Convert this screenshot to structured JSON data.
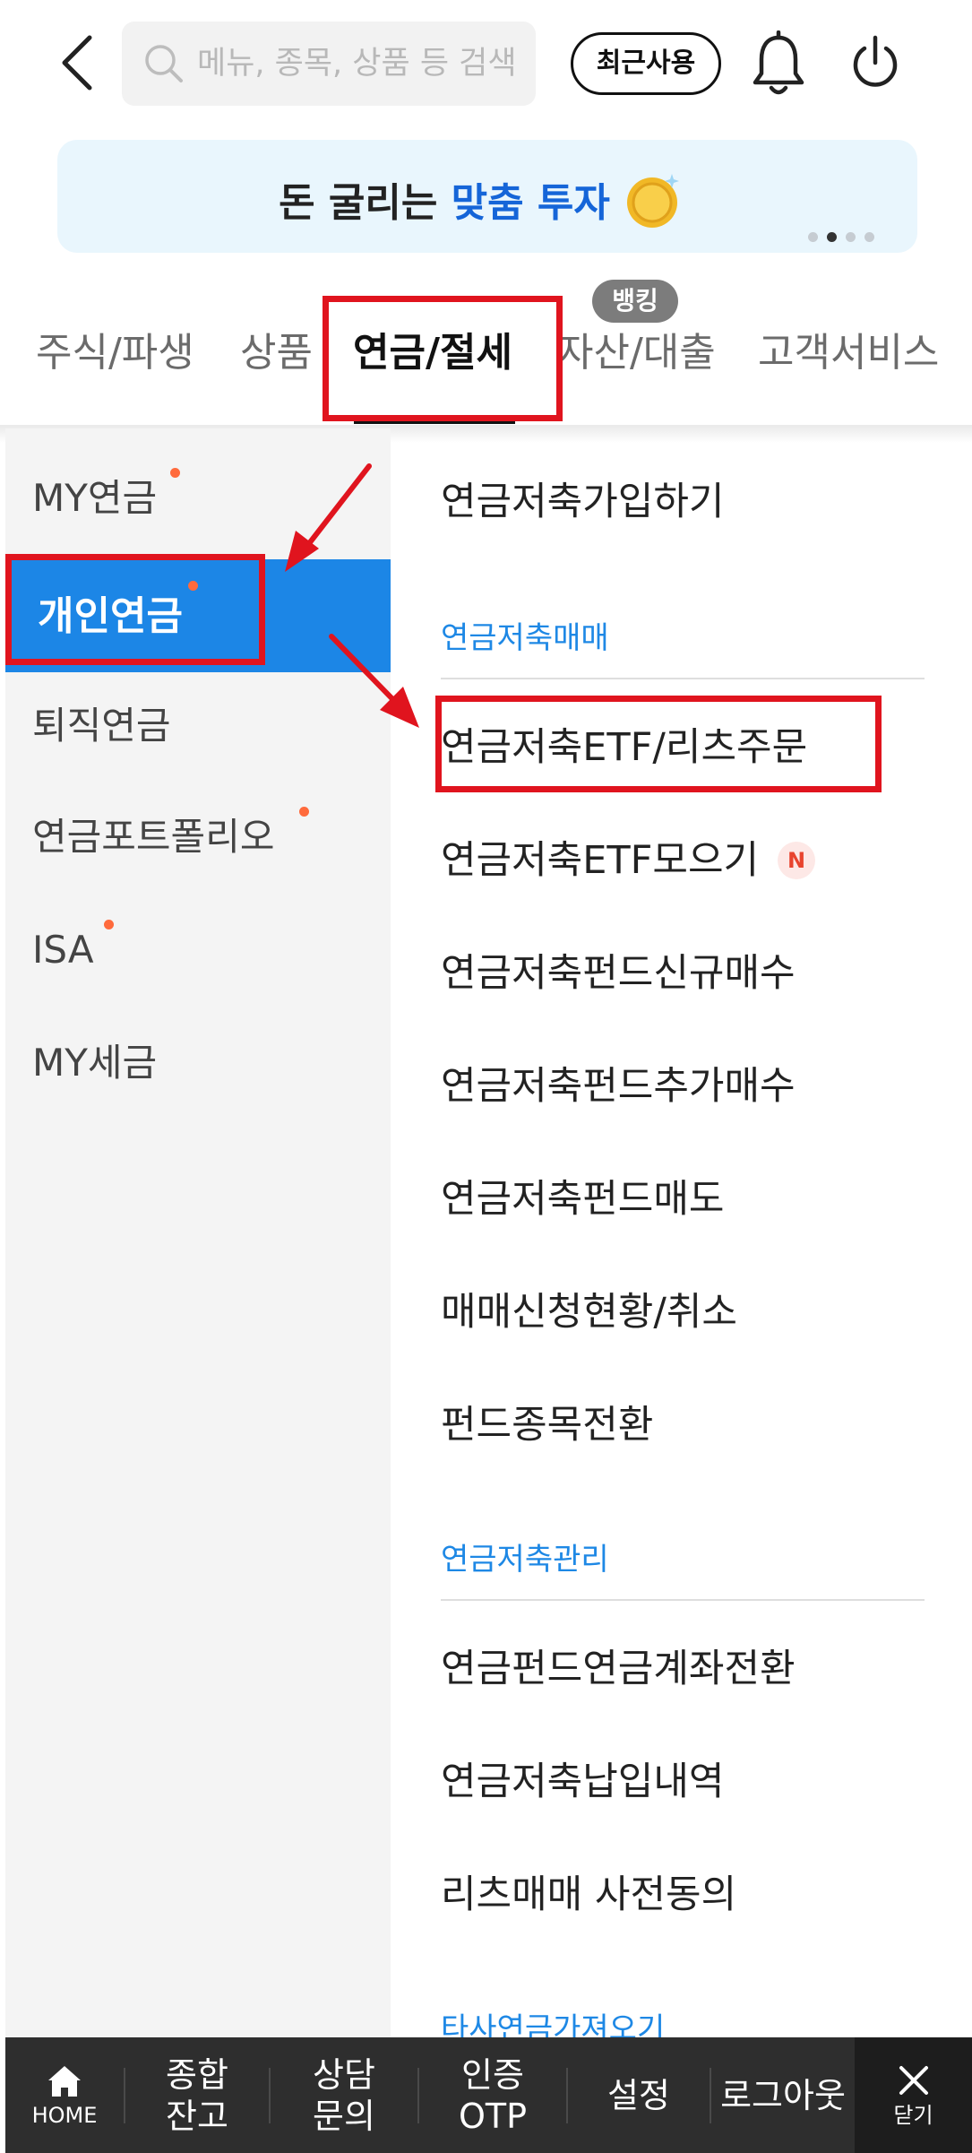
{
  "search": {
    "placeholder": "메뉴, 종목, 상품 등 검색"
  },
  "header": {
    "recent_label": "최근사용"
  },
  "banner": {
    "text_normal": "돈 굴리는 ",
    "text_highlight": "맞춤 투자",
    "page_count": 4,
    "active_page": 2
  },
  "tabs": [
    {
      "label": "주식/파생"
    },
    {
      "label": "상품"
    },
    {
      "label": "연금/절세",
      "active": true
    },
    {
      "label": "자산/대출",
      "badge": "뱅킹"
    },
    {
      "label": "고객서비스"
    }
  ],
  "left_menu": [
    {
      "label": "MY연금",
      "dot": true
    },
    {
      "label": "개인연금",
      "dot": true,
      "active": true
    },
    {
      "label": "퇴직연금",
      "dot": false
    },
    {
      "label": "연금포트폴리오",
      "dot": true
    },
    {
      "label": "ISA",
      "dot": true
    },
    {
      "label": "MY세금",
      "dot": false
    }
  ],
  "right_menu": {
    "top_item": "연금저축가입하기",
    "sections": [
      {
        "title": "연금저축매매",
        "items": [
          {
            "label": "연금저축ETF/리츠주문"
          },
          {
            "label": "연금저축ETF모으기",
            "badge": "N"
          },
          {
            "label": "연금저축펀드신규매수"
          },
          {
            "label": "연금저축펀드추가매수"
          },
          {
            "label": "연금저축펀드매도"
          },
          {
            "label": "매매신청현황/취소"
          },
          {
            "label": "펀드종목전환"
          }
        ]
      },
      {
        "title": "연금저축관리",
        "items": [
          {
            "label": "연금펀드연금계좌전환"
          },
          {
            "label": "연금저축납입내역"
          },
          {
            "label": "리츠매매 사전동의"
          }
        ]
      },
      {
        "title": "타사연금가져오기"
      }
    ]
  },
  "bottom_bar": {
    "home": "HOME",
    "items": [
      {
        "line1": "종합",
        "line2": "잔고"
      },
      {
        "line1": "상담",
        "line2": "문의"
      },
      {
        "line1": "인증",
        "line2": "OTP"
      },
      {
        "line1": "설정"
      },
      {
        "line1": "로그아웃"
      }
    ],
    "close": "닫기"
  },
  "colors": {
    "accent_blue": "#1c86e6",
    "highlight_red": "#e0141e",
    "section_blue": "#1e88e5"
  }
}
